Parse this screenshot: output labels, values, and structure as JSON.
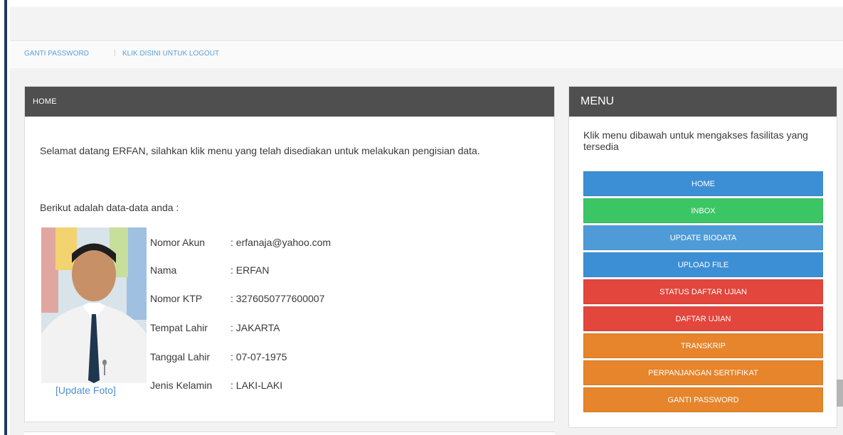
{
  "nav": {
    "ganti_password": "GANTI PASSWORD",
    "separator": "|",
    "logout": "KLIK DISINI UNTUK LOGOUT"
  },
  "home": {
    "title": "HOME",
    "welcome": "Selamat datang ERFAN, silahkan klik menu yang telah disediakan untuk melakukan pengisian data.",
    "subhead": "Berikut adalah data-data anda :",
    "update_foto": "[Update Foto]",
    "info": [
      {
        "label": "Nomor Akun",
        "value": ": erfanaja@yahoo.com"
      },
      {
        "label": "Nama",
        "value": ": ERFAN"
      },
      {
        "label": "Nomor KTP",
        "value": ": 3276050777600007"
      },
      {
        "label": "Tempat Lahir",
        "value": ": JAKARTA"
      },
      {
        "label": "Tanggal Lahir",
        "value": ": 07-07-1975"
      },
      {
        "label": "Jenis Kelamin",
        "value": ": LAKI-LAKI"
      }
    ]
  },
  "menu": {
    "title": "MENU",
    "description": "Klik menu dibawah untuk mengakses fasilitas yang tersedia",
    "items": [
      {
        "label": "HOME",
        "color": "#3d8fd5"
      },
      {
        "label": "INBOX",
        "color": "#3cc565"
      },
      {
        "label": "UPDATE BIODATA",
        "color": "#4f9bd8"
      },
      {
        "label": "UPLOAD FILE",
        "color": "#3d8fd5"
      },
      {
        "label": "STATUS DAFTAR UJIAN",
        "color": "#e2463c"
      },
      {
        "label": "DAFTAR UJIAN",
        "color": "#e2463c"
      },
      {
        "label": "TRANSKRIP",
        "color": "#e6852b"
      },
      {
        "label": "PERPANJANGAN SERTIFIKAT",
        "color": "#e6852b"
      },
      {
        "label": "GANTI PASSWORD",
        "color": "#e6852b"
      }
    ]
  }
}
